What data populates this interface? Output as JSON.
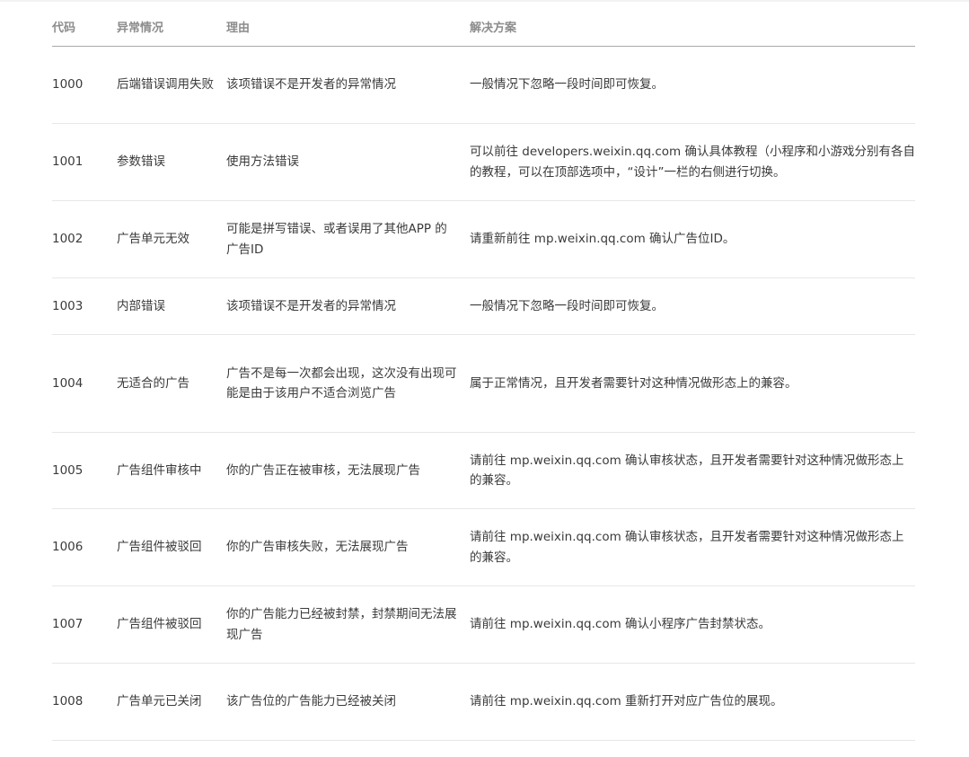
{
  "table": {
    "headers": [
      "代码",
      "异常情况",
      "理由",
      "解决方案"
    ],
    "rows": [
      {
        "code": "1000",
        "case": "后端错误调用失败",
        "reason": "该项错误不是开发者的异常情况",
        "solution": "一般情况下忽略一段时间即可恢复。"
      },
      {
        "code": "1001",
        "case": "参数错误",
        "reason": "使用方法错误",
        "solution": "可以前往 developers.weixin.qq.com 确认具体教程（小程序和小游戏分别有各自的教程，可以在顶部选项中，“设计”一栏的右侧进行切换。"
      },
      {
        "code": "1002",
        "case": "广告单元无效",
        "reason": "可能是拼写错误、或者误用了其他APP 的广告ID",
        "solution": "请重新前往 mp.weixin.qq.com 确认广告位ID。"
      },
      {
        "code": "1003",
        "case": "内部错误",
        "reason": "该项错误不是开发者的异常情况",
        "solution": "一般情况下忽略一段时间即可恢复。"
      },
      {
        "code": "1004",
        "case": "无适合的广告",
        "reason": "广告不是每一次都会出现，这次没有出现可能是由于该用户不适合浏览广告",
        "solution": "属于正常情况，且开发者需要针对这种情况做形态上的兼容。"
      },
      {
        "code": "1005",
        "case": "广告组件审核中",
        "reason": "你的广告正在被审核，无法展现广告",
        "solution": "请前往 mp.weixin.qq.com 确认审核状态，且开发者需要针对这种情况做形态上的兼容。"
      },
      {
        "code": "1006",
        "case": "广告组件被驳回",
        "reason": "你的广告审核失败，无法展现广告",
        "solution": "请前往 mp.weixin.qq.com 确认审核状态，且开发者需要针对这种情况做形态上的兼容。"
      },
      {
        "code": "1007",
        "case": "广告组件被驳回",
        "reason": "你的广告能力已经被封禁，封禁期间无法展现广告",
        "solution": "请前往 mp.weixin.qq.com 确认小程序广告封禁状态。"
      },
      {
        "code": "1008",
        "case": "广告单元已关闭",
        "reason": "该广告位的广告能力已经被关闭",
        "solution": "请前往 mp.weixin.qq.com 重新打开对应广告位的展现。"
      }
    ]
  }
}
